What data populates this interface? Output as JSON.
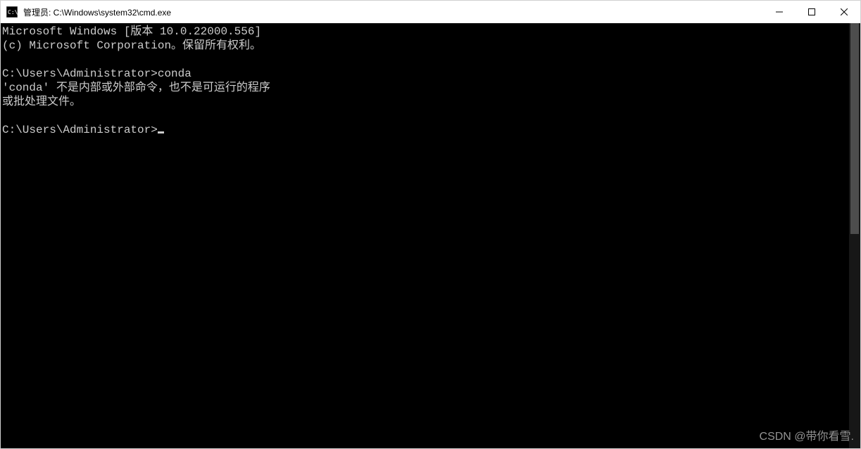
{
  "titlebar": {
    "title": "管理员: C:\\Windows\\system32\\cmd.exe",
    "icon": "cmd-icon"
  },
  "controls": {
    "minimize": "minimize",
    "maximize": "maximize",
    "close": "close"
  },
  "terminal": {
    "lines": [
      "Microsoft Windows [版本 10.0.22000.556]",
      "(c) Microsoft Corporation。保留所有权利。",
      "",
      "C:\\Users\\Administrator>conda",
      "'conda' 不是内部或外部命令，也不是可运行的程序",
      "或批处理文件。",
      "",
      "C:\\Users\\Administrator>"
    ],
    "cursor_line_index": 7
  },
  "watermark": "CSDN @带你看雪."
}
